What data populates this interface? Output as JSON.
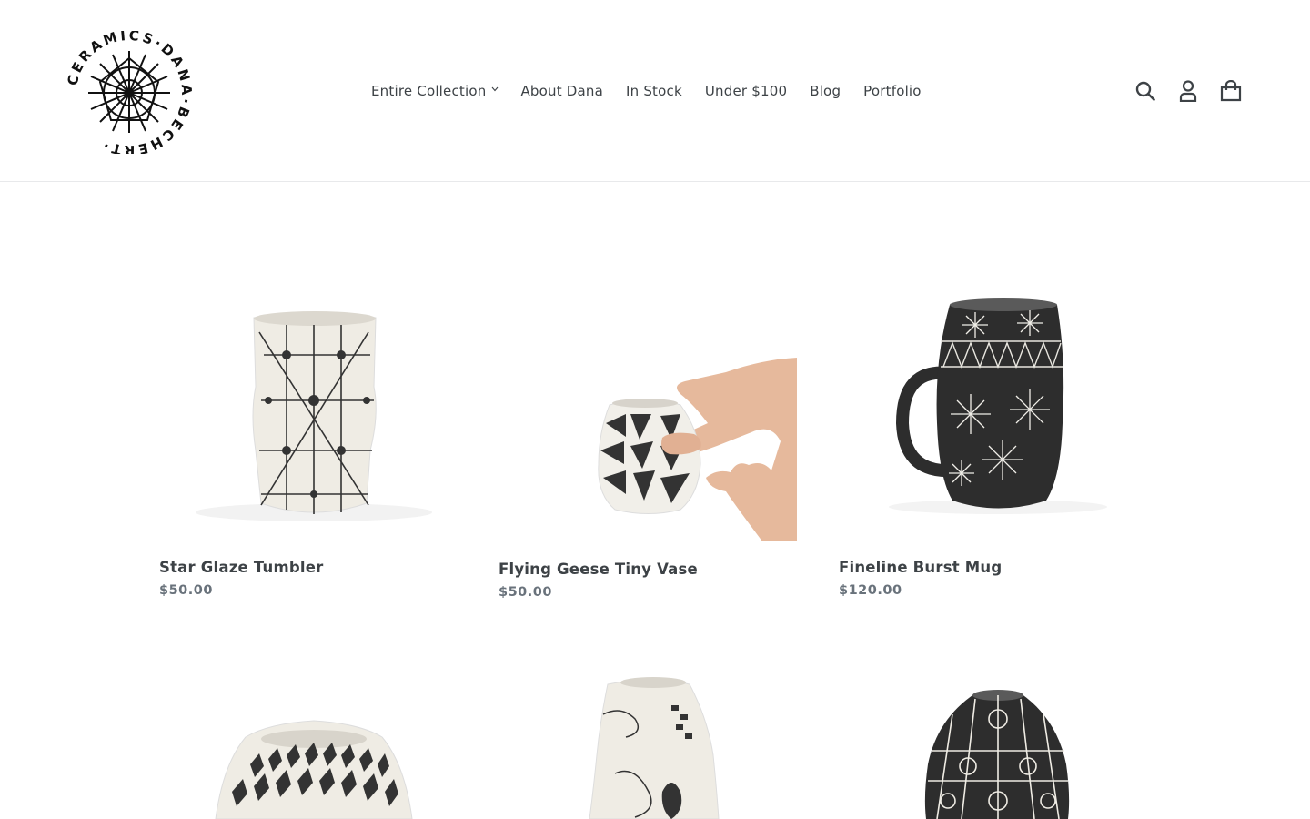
{
  "brand": {
    "logo_text": "DANA · BECHERT · CERAMICS",
    "logo_icon": "starburst-seal"
  },
  "nav": {
    "items": [
      {
        "label": "Entire Collection",
        "has_dropdown": true
      },
      {
        "label": "About Dana"
      },
      {
        "label": "In Stock"
      },
      {
        "label": "Under $100"
      },
      {
        "label": "Blog"
      },
      {
        "label": "Portfolio"
      }
    ]
  },
  "header_icons": [
    "search-icon",
    "account-icon",
    "cart-icon"
  ],
  "products": [
    {
      "title": "Star Glaze Tumbler",
      "price": "$50.00"
    },
    {
      "title": "Flying Geese Tiny Vase",
      "price": "$50.00"
    },
    {
      "title": "Fineline Burst Mug",
      "price": "$120.00"
    },
    {
      "title": "",
      "price": ""
    },
    {
      "title": "",
      "price": ""
    },
    {
      "title": "",
      "price": ""
    }
  ],
  "colors": {
    "text": "#3d4246",
    "price": "#69727b",
    "border": "#e8e9eb",
    "ceramic": "#f2f0ea",
    "glaze_dark": "#2d2d2d"
  }
}
